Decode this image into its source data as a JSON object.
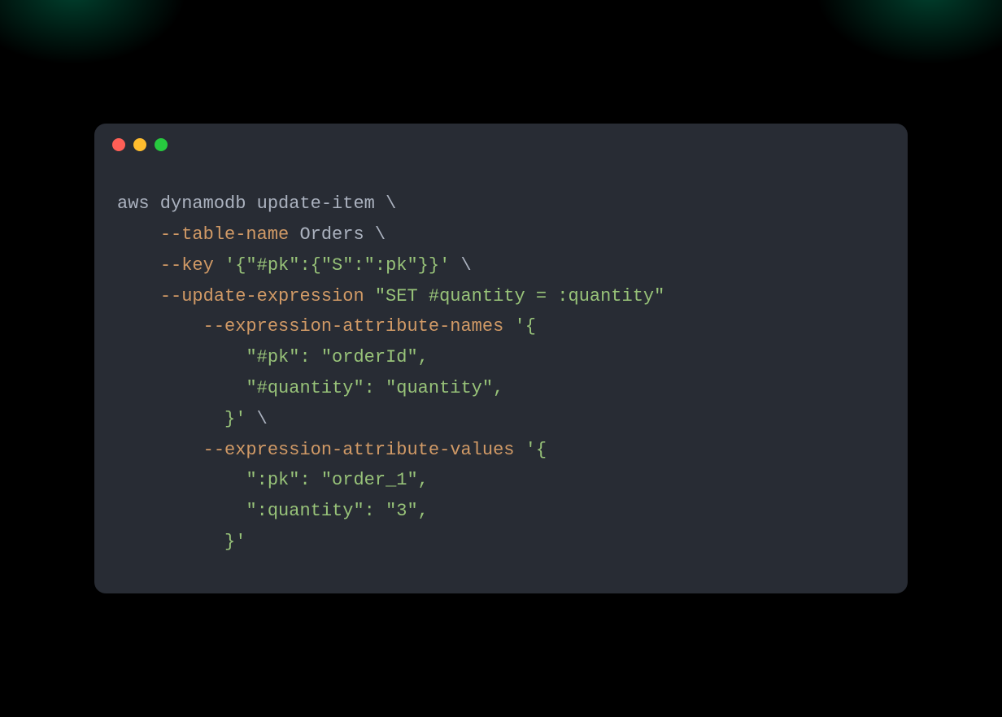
{
  "traffic_lights": {
    "red": "#ff5f56",
    "yellow": "#ffbd2e",
    "green": "#27c93f"
  },
  "code": {
    "lines": [
      {
        "indent": 0,
        "segments": [
          {
            "cls": "tok-cmd",
            "text": "aws dynamodb update-item "
          },
          {
            "cls": "tok-cont",
            "text": "\\"
          }
        ]
      },
      {
        "indent": 1,
        "segments": [
          {
            "cls": "tok-flag",
            "text": "--table-name"
          },
          {
            "cls": "tok-arg",
            "text": " Orders "
          },
          {
            "cls": "tok-cont",
            "text": "\\"
          }
        ]
      },
      {
        "indent": 1,
        "segments": [
          {
            "cls": "tok-flag",
            "text": "--key"
          },
          {
            "cls": "tok-plain",
            "text": " "
          },
          {
            "cls": "tok-str",
            "text": "'{\"#pk\":{\"S\":\":pk\"}}'"
          },
          {
            "cls": "tok-plain",
            "text": " "
          },
          {
            "cls": "tok-cont",
            "text": "\\"
          }
        ]
      },
      {
        "indent": 1,
        "segments": [
          {
            "cls": "tok-flag",
            "text": "--update-expression"
          },
          {
            "cls": "tok-plain",
            "text": " "
          },
          {
            "cls": "tok-str",
            "text": "\"SET #quantity = :quantity\""
          }
        ]
      },
      {
        "indent": 2,
        "segments": [
          {
            "cls": "tok-flag",
            "text": "--expression-attribute-names"
          },
          {
            "cls": "tok-plain",
            "text": " "
          },
          {
            "cls": "tok-str",
            "text": "'{"
          }
        ]
      },
      {
        "indent": 3,
        "segments": [
          {
            "cls": "tok-str",
            "text": "\"#pk\": \"orderId\","
          }
        ]
      },
      {
        "indent": 3,
        "segments": [
          {
            "cls": "tok-str",
            "text": "\"#quantity\": \"quantity\","
          }
        ]
      },
      {
        "indent": 2,
        "segments": [
          {
            "cls": "tok-str",
            "text": "  }'"
          },
          {
            "cls": "tok-plain",
            "text": " "
          },
          {
            "cls": "tok-cont",
            "text": "\\"
          }
        ]
      },
      {
        "indent": 2,
        "segments": [
          {
            "cls": "tok-flag",
            "text": "--expression-attribute-values"
          },
          {
            "cls": "tok-plain",
            "text": " "
          },
          {
            "cls": "tok-str",
            "text": "'{"
          }
        ]
      },
      {
        "indent": 3,
        "segments": [
          {
            "cls": "tok-str",
            "text": "\":pk\": \"order_1\","
          }
        ]
      },
      {
        "indent": 3,
        "segments": [
          {
            "cls": "tok-str",
            "text": "\":quantity\": \"3\","
          }
        ]
      },
      {
        "indent": 2,
        "segments": [
          {
            "cls": "tok-str",
            "text": "  }'"
          }
        ]
      }
    ],
    "indent_unit": "    "
  }
}
